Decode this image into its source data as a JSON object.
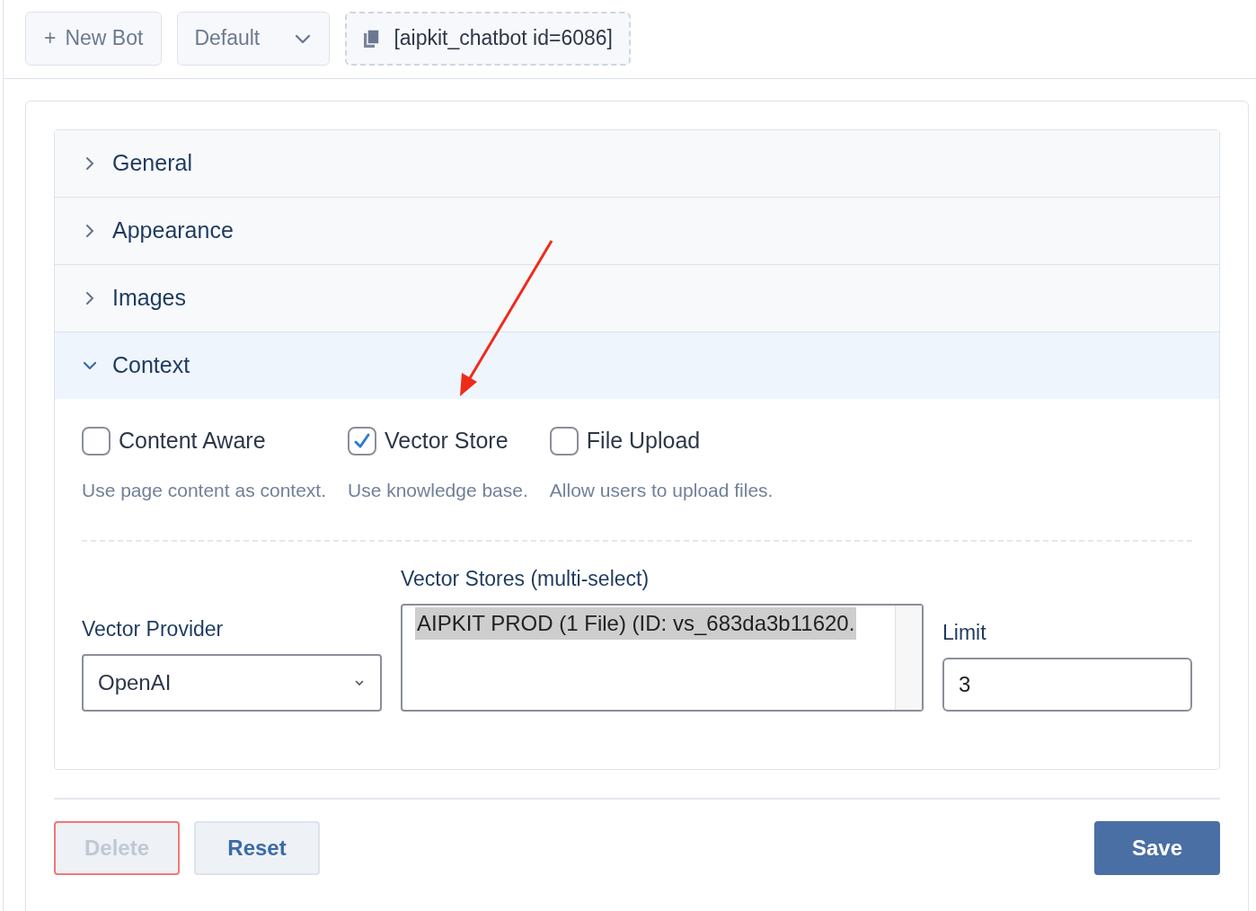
{
  "toolbar": {
    "new_bot": {
      "icon": "+",
      "label": "New Bot"
    },
    "bot_select": {
      "value": "Default"
    },
    "shortcode": "[aipkit_chatbot id=6086]"
  },
  "sections": [
    {
      "title": "General",
      "expanded": false
    },
    {
      "title": "Appearance",
      "expanded": false
    },
    {
      "title": "Images",
      "expanded": false
    },
    {
      "title": "Context",
      "expanded": true
    }
  ],
  "context": {
    "options": [
      {
        "label": "Content Aware",
        "checked": false,
        "description": "Use page content as context."
      },
      {
        "label": "Vector Store",
        "checked": true,
        "description": "Use knowledge base."
      },
      {
        "label": "File Upload",
        "checked": false,
        "description": "Allow users to upload files."
      }
    ],
    "vector_provider": {
      "label": "Vector Provider",
      "value": "OpenAI"
    },
    "vector_stores": {
      "label": "Vector Stores (multi-select)",
      "options": [
        {
          "label": "AIPKIT PROD (1 File) (ID: vs_683da3b11620.",
          "selected": true
        }
      ]
    },
    "limit": {
      "label": "Limit",
      "value": "3"
    }
  },
  "actions": [
    {
      "label": "Delete",
      "kind": "danger",
      "disabled": true
    },
    {
      "label": "Reset",
      "kind": "secondary",
      "disabled": false
    },
    {
      "label": "Save",
      "kind": "primary",
      "disabled": false
    }
  ]
}
